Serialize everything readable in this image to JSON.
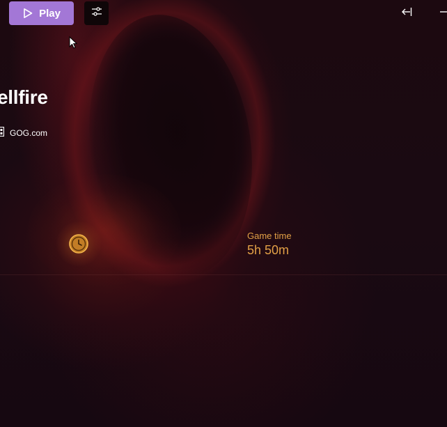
{
  "toolbar": {
    "play_label": "Play",
    "play_icon": "play-icon",
    "settings_icon": "sliders-icon",
    "collapse_icon": "arrow-left-to-line-icon",
    "minimize_icon": "minus-icon"
  },
  "game": {
    "title": "ellfire",
    "source_label": "GOG.com",
    "source_icon": "gog-store-icon"
  },
  "stats": {
    "game_time_label": "Game time",
    "game_time_value": "5h 50m",
    "icon": "clock-icon"
  },
  "colors": {
    "play_accent": "#a377d6",
    "stat_accent": "#e2a046",
    "background": "#1a0a10"
  }
}
